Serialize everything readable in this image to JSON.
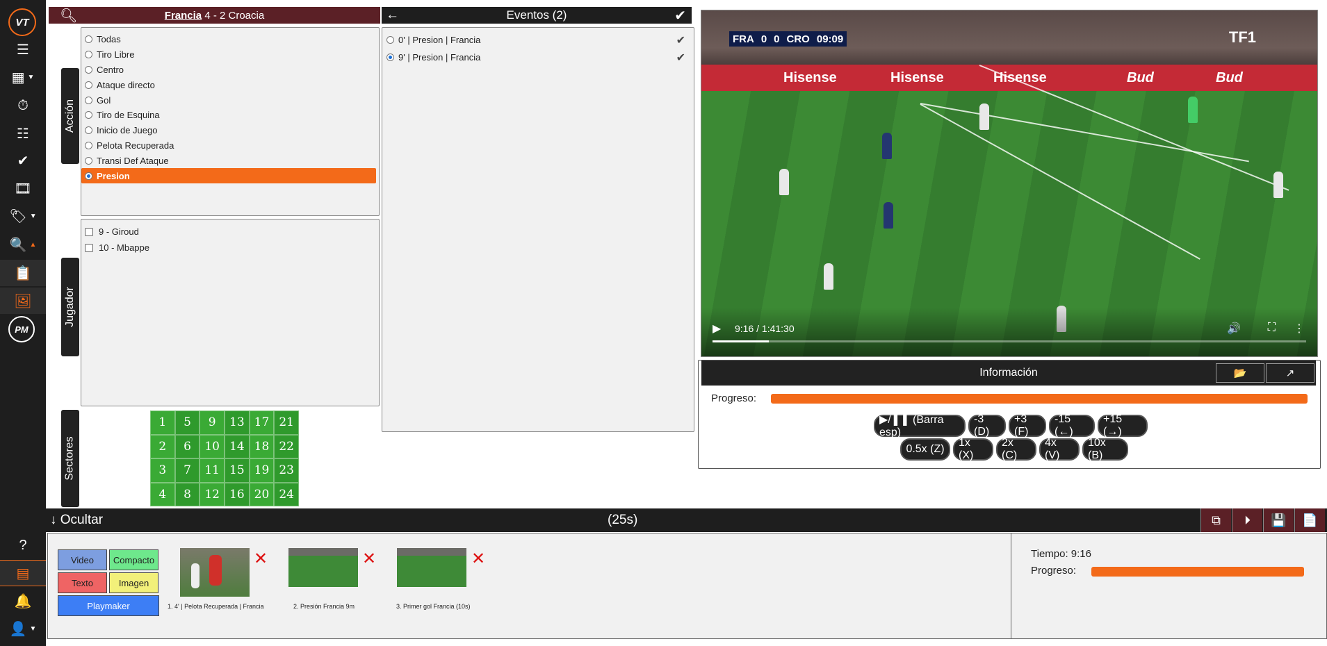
{
  "sidebar": {
    "logo": "VT",
    "pm_logo": "PM",
    "help": "?"
  },
  "match": {
    "team_home": "Francia",
    "score": "4 - 2",
    "team_away": "Croacia"
  },
  "accion": {
    "tab_label": "Acción",
    "options": [
      "Todas",
      "Tiro Libre",
      "Centro",
      "Ataque directo",
      "Gol",
      "Tiro de Esquina",
      "Inicio de Juego",
      "Pelota Recuperada",
      "Transi Def Ataque",
      "Presion"
    ],
    "selected": "Presion"
  },
  "jugador": {
    "tab_label": "Jugador",
    "players": [
      "9 - Giroud",
      "10 - Mbappe"
    ]
  },
  "sectores": {
    "tab_label": "Sectores",
    "grid": [
      [
        "1",
        "5",
        "9",
        "13",
        "17",
        "21"
      ],
      [
        "2",
        "6",
        "10",
        "14",
        "18",
        "22"
      ],
      [
        "3",
        "7",
        "11",
        "15",
        "19",
        "23"
      ],
      [
        "4",
        "8",
        "12",
        "16",
        "20",
        "24"
      ]
    ]
  },
  "eventos": {
    "title": "Eventos (2)",
    "items": [
      {
        "label": "0' | Presion | Francia",
        "selected": false
      },
      {
        "label": "9' | Presion | Francia",
        "selected": true
      }
    ]
  },
  "video": {
    "scoreboard": {
      "home": "FRA",
      "home_score": "0",
      "away_score": "0",
      "away": "CRO",
      "clock": "09:09"
    },
    "board_text": [
      "Hisense",
      "Hisense",
      "Hisense",
      "Bud",
      "Bud"
    ],
    "broadcaster": "TF1",
    "time": "9:16 / 1:41:30",
    "progress": 0.095
  },
  "info": {
    "title": "Información",
    "progress_label": "Progreso:",
    "progress": 1.0,
    "controls_row1": [
      "▶/❚❚ (Barra esp)",
      "-3 (D)",
      "+3 (F)",
      "-15 (←)",
      "+15 (→)"
    ],
    "controls_row2": [
      "0.5x (Z)",
      "1x (X)",
      "2x (C)",
      "4x (V)",
      "10x (B)"
    ]
  },
  "bottom": {
    "hide_label": "Ocultar",
    "duration": "(25s)",
    "modes": {
      "video": "Video",
      "compacto": "Compacto",
      "texto": "Texto",
      "imagen": "Imagen",
      "playmaker": "Playmaker"
    },
    "clips": [
      {
        "caption": "1. 4' | Pelota Recuperada | Francia"
      },
      {
        "caption": "2. Presión Francia 9m"
      },
      {
        "caption": "3. Primer gol Francia (10s)"
      }
    ],
    "tiempo_label": "Tiempo: 9:16",
    "progress_label": "Progreso:",
    "progress": 1.0
  },
  "colors": {
    "accent": "#f36a19",
    "header_maroon": "#5b2026",
    "dark": "#1e1e1e"
  }
}
